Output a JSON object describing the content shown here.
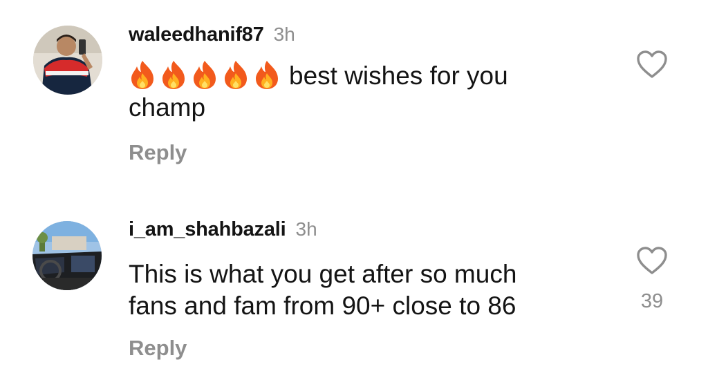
{
  "comments": [
    {
      "username": "waleedhanif87",
      "time": "3h",
      "emojis": [
        "🔥",
        "🔥",
        "🔥",
        "🔥",
        "🔥"
      ],
      "text": "best wishes for you champ",
      "reply_label": "Reply",
      "likes": ""
    },
    {
      "username": "i_am_shahbazali",
      "time": "3h",
      "text": "This is what you get after so much fans and fam from 90+ close to 86",
      "reply_label": "Reply",
      "likes": "39"
    }
  ]
}
